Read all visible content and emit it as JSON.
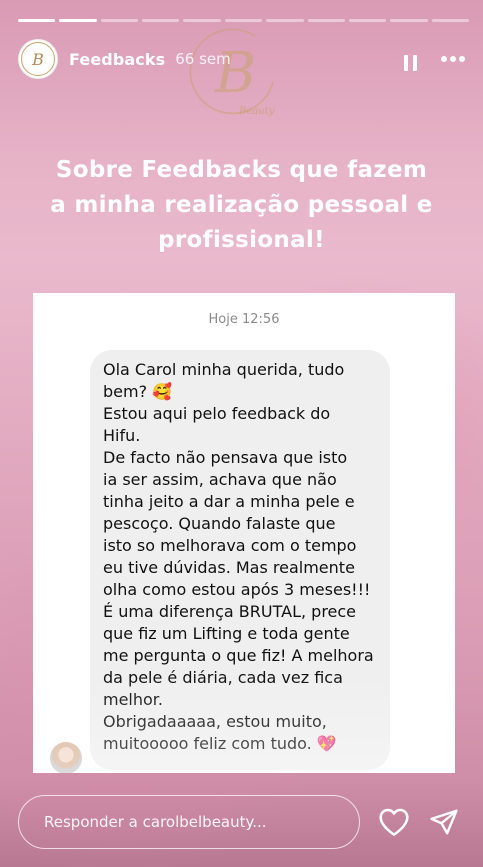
{
  "story": {
    "progress": {
      "total": 11,
      "current": 2
    },
    "header": {
      "username": "Feedbacks",
      "time": "66 sem",
      "avatar_letter": "B",
      "watermark_letter": "B",
      "watermark_text": "Beauty"
    },
    "headline": {
      "line1": "Sobre Feedbacks que fazem",
      "line2": "a minha realização pessoal e",
      "line3": "profissional!"
    },
    "screenshot": {
      "timestamp": "Hoje 12:56",
      "message_lines": [
        "Ola Carol minha querida, tudo",
        "bem? 🥰",
        "Estou aqui pelo feedback do",
        "Hifu.",
        "De facto não pensava que isto",
        "ia ser assim, achava que não",
        "tinha jeito a dar a minha pele e",
        "pescoço. Quando falaste que",
        "isto so melhorava com o tempo",
        "eu tive dúvidas. Mas realmente",
        "olha como estou após 3 meses!!!",
        "É uma diferença BRUTAL, prece",
        "que fiz um Lifting e toda gente",
        "me pergunta o que fiz! A melhora",
        "da pele é diária, cada vez fica",
        "melhor.",
        "Obrigadaaaaa, estou muito,",
        "muitooooo feliz com tudo. 💖"
      ]
    },
    "reply": {
      "placeholder": "Responder a carolbelbeauty..."
    },
    "colors": {
      "accent_gold": "#c9a36e",
      "text_white": "#ffffff"
    },
    "icons": [
      "pause-icon",
      "more-icon",
      "heart-icon",
      "send-icon"
    ]
  }
}
